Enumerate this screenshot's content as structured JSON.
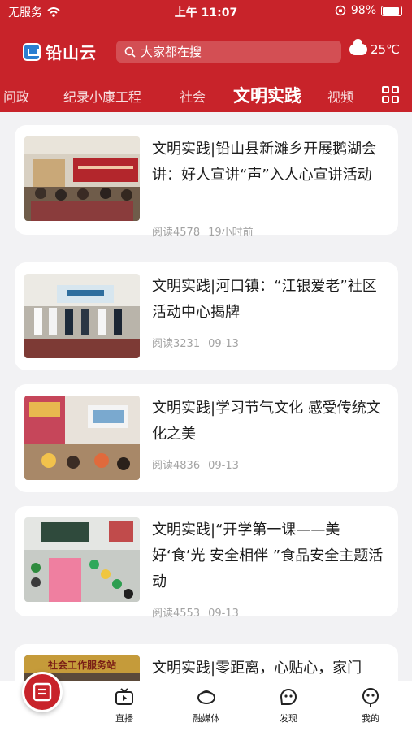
{
  "status_bar": {
    "carrier": "无服务",
    "time": "上午 11:07",
    "battery": "98%"
  },
  "header": {
    "app_name": "铅山云",
    "search_placeholder": "大家都在搜",
    "temperature": "25℃",
    "weather_icon": "cloud-icon",
    "tabs": [
      {
        "label": "问政",
        "active": false
      },
      {
        "label": "纪录小康工程",
        "active": false
      },
      {
        "label": "社会",
        "active": false
      },
      {
        "label": "文明实践",
        "active": true
      },
      {
        "label": "视频",
        "active": false
      }
    ]
  },
  "articles": [
    {
      "title": "文明实践|铅山县新滩乡开展鹅湖会讲：好人宣讲“声”入人心宣讲活动",
      "reads": "阅读4578",
      "date": "19小时前"
    },
    {
      "title": "文明实践|河口镇：“江银爱老”社区活动中心揭牌",
      "reads": "阅读3231",
      "date": "09-13"
    },
    {
      "title": "文明实践|学习节气文化 感受传统文化之美",
      "reads": "阅读4836",
      "date": "09-13"
    },
    {
      "title": "文明实践|“开学第一课——美好‘食’光 安全相伴 ”食品安全主题活动",
      "reads": "阅读4553",
      "date": "09-13"
    },
    {
      "title": "文明实践|零距离，心贴心，家门",
      "thumb_text": "社会工作服务站"
    }
  ],
  "bottom_nav": [
    {
      "label": "",
      "icon": "home-news-icon"
    },
    {
      "label": "直播",
      "icon": "tv-icon"
    },
    {
      "label": "融媒体",
      "icon": "media-icon"
    },
    {
      "label": "发现",
      "icon": "discover-icon"
    },
    {
      "label": "我的",
      "icon": "profile-icon"
    }
  ],
  "colors": {
    "brand_red": "#c8232a",
    "meta_gray": "#a3a3a3",
    "background": "#f2f2f4"
  }
}
